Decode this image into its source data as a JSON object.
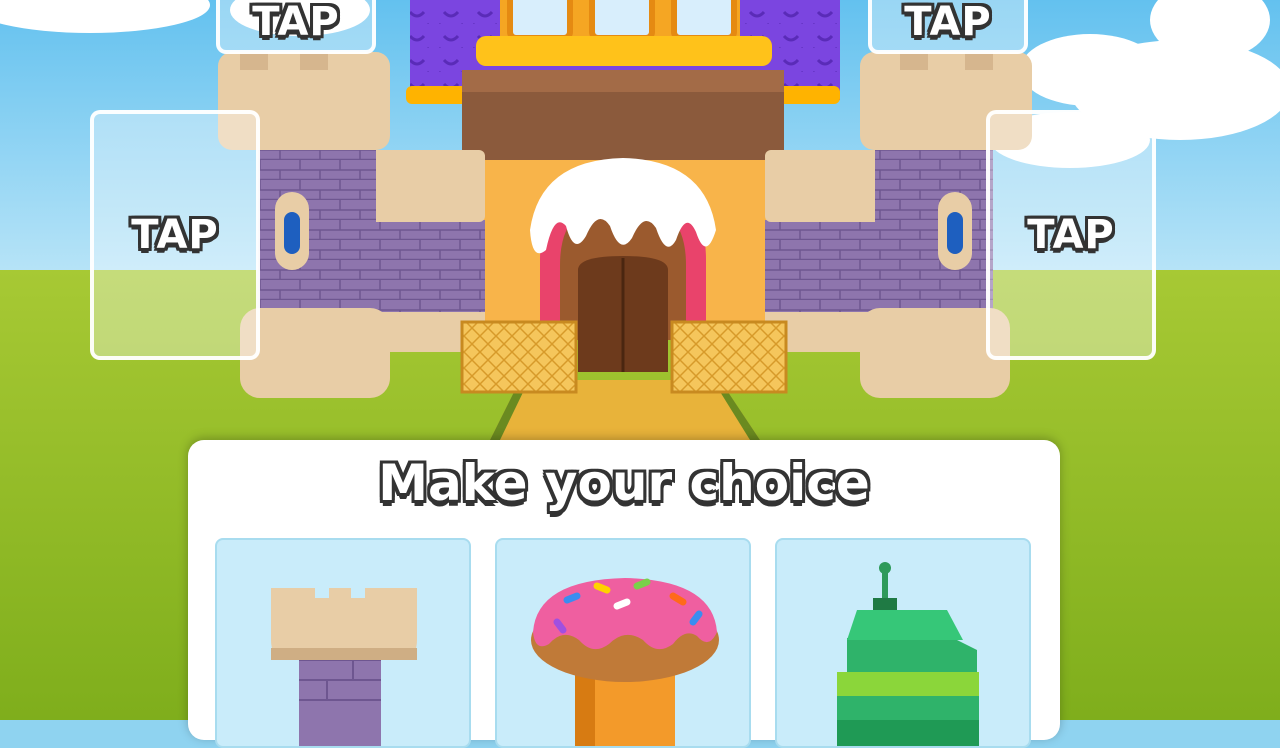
{
  "tap_slots": [
    {
      "id": "top-left",
      "label": "TAP"
    },
    {
      "id": "mid-left",
      "label": "TAP"
    },
    {
      "id": "top-right",
      "label": "TAP"
    },
    {
      "id": "mid-right",
      "label": "TAP"
    }
  ],
  "panel": {
    "title": "Make your choice",
    "options": [
      {
        "name": "castle-tower",
        "icon": "stone-tower-icon"
      },
      {
        "name": "donut-tower",
        "icon": "donut-tower-icon"
      },
      {
        "name": "robot-tower",
        "icon": "green-robot-tower-icon"
      }
    ]
  },
  "colors": {
    "sky": "#8fd3f0",
    "grass": "#9cc22c",
    "castle_purple": "#8b6fae",
    "castle_roof": "#7a3fd6",
    "sand": "#e9cfa8",
    "path": "#e8b33a"
  }
}
